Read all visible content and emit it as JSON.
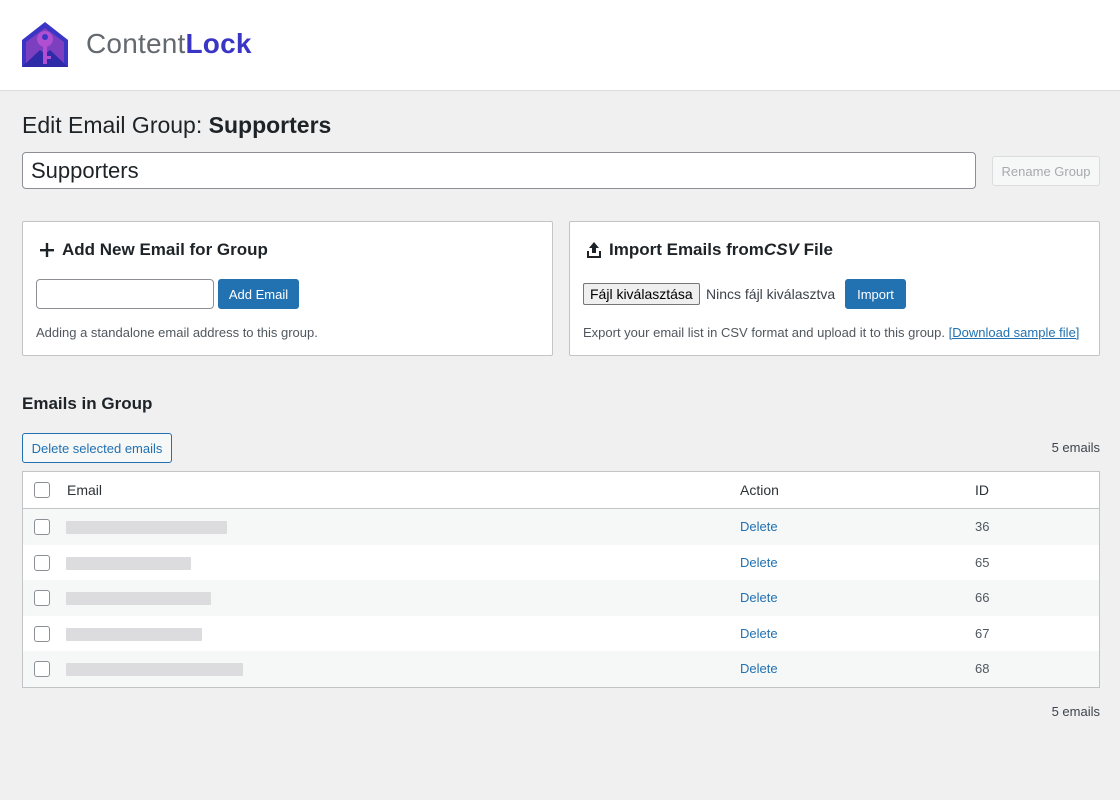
{
  "brand": {
    "name_light": "Content",
    "name_bold": "Lock"
  },
  "page": {
    "title_prefix": "Edit Email Group: ",
    "title_group": "Supporters"
  },
  "group": {
    "name_value": "Supporters",
    "rename_label": "Rename Group"
  },
  "add_card": {
    "title": "Add New Email for Group",
    "input_value": "",
    "button_label": "Add Email",
    "help": "Adding a standalone email address to this group."
  },
  "import_card": {
    "title_prefix": "Import Emails from ",
    "title_italic": "CSV",
    "title_suffix": " File",
    "file_button": "Fájl kiválasztása",
    "file_status": "Nincs fájl kiválasztva",
    "button_label": "Import",
    "help": "Export your email list in CSV format and upload it to this group. ",
    "download_link": "[Download sample file]"
  },
  "list": {
    "section_title": "Emails in Group",
    "delete_selected": "Delete selected emails",
    "count_top": "5 emails",
    "count_bottom": "5 emails",
    "columns": {
      "email": "Email",
      "action": "Action",
      "id": "ID"
    },
    "rows": [
      {
        "action": "Delete",
        "id": "36"
      },
      {
        "action": "Delete",
        "id": "65"
      },
      {
        "action": "Delete",
        "id": "66"
      },
      {
        "action": "Delete",
        "id": "67"
      },
      {
        "action": "Delete",
        "id": "68"
      }
    ]
  },
  "colors": {
    "accent": "#2271b1",
    "brand": "#3b35c6"
  },
  "icons": {
    "logo": "envelope-key-logo",
    "add": "plus-icon",
    "import": "upload-icon"
  }
}
